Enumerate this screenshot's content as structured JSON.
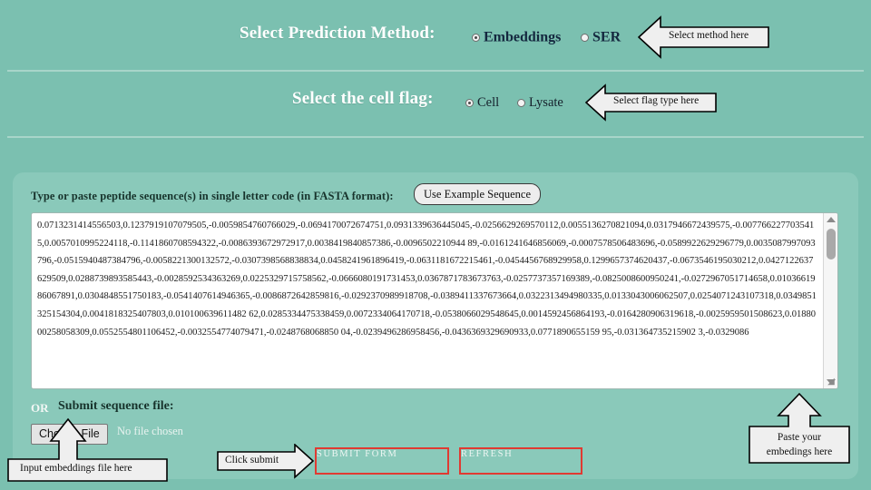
{
  "theme": {
    "background": "#7bc0b0",
    "panel": "#8ac9ba",
    "divider": "#a8d5c9",
    "accent_red": "#e03a32",
    "heading_text": "#ffffff",
    "option_text_dark": "#14283f",
    "callout_fill": "#efefef",
    "callout_border": "#000000"
  },
  "method_row": {
    "title": "Select Prediction Method:",
    "options": [
      {
        "label": "Embeddings",
        "selected": true
      },
      {
        "label": "SER",
        "selected": false
      }
    ],
    "callout": "Select method here"
  },
  "flag_row": {
    "title": "Select the cell flag:",
    "options": [
      {
        "label": "Cell",
        "selected": true
      },
      {
        "label": "Lysate",
        "selected": false
      }
    ],
    "callout": "Select flag type here"
  },
  "sequence": {
    "label": "Type or paste peptide sequence(s) in single letter code (in FASTA format):",
    "example_button": "Use Example Sequence",
    "placeholder": "",
    "value": "0.0713231414556503,0.1237919107079505,-0.0059854760766029,-0.0694170072674751,0.0931339636445045,-0.0256629269570112,0.0055136270821094,0.0317946672439575,-0.0077662277035415,0.0057010995224118,-0.1141860708594322,-0.0086393672972917,0.0038419840857386,-0.0096502210944 89,-0.0161241646856069,-0.0007578506483696,-0.0589922629296779,0.0035087997093796,-0.0515940487384796,-0.0058221300132572,-0.0307398568838834,0.0458241961896419,-0.0631181672215461,-0.0454456768929958,0.1299657374620437,-0.0673546195030212,0.0427122637629509,0.0288739893585443,-0.0028592534363269,0.0225329715758562,-0.0666080191731453,0.0367871783673763,-0.0257737357169389,-0.0825008600950241,-0.0272967051714658,0.0103661986067891,0.0304848551750183,-0.0541407614946365,-0.0086872642859816,-0.0292370989918708,-0.0389411337673664,0.0322313494980335,0.0133043006062507,0.0254071243107318,0.0349851325154304,0.0041818325407803,0.010100639611482 62,0.0285334475338459,0.0072334064170718,-0.0538066029548645,0.0014592456864193,-0.0164280906319618,-0.0025959501508623,0.0188000258058309,0.0552554801106452,-0.0032554774079471,-0.0248768068850 04,-0.0239496286958456,-0.0436369329690933,0.0771890655159 95,-0.031364735215902 3,-0.0329086",
    "scrollbar": {
      "visible": true
    },
    "callout": "Paste your\nembedings here",
    "callout_line1": "Paste your",
    "callout_line2": "embedings here"
  },
  "file_row": {
    "or": "OR",
    "label": "Submit sequence file:",
    "choose_button": "Choose File",
    "status": "No file chosen",
    "callout": "Input embeddings file here"
  },
  "actions": {
    "submit_label": "SUBMIT FORM",
    "refresh_label": "REFRESH",
    "callout": "Click submit"
  }
}
